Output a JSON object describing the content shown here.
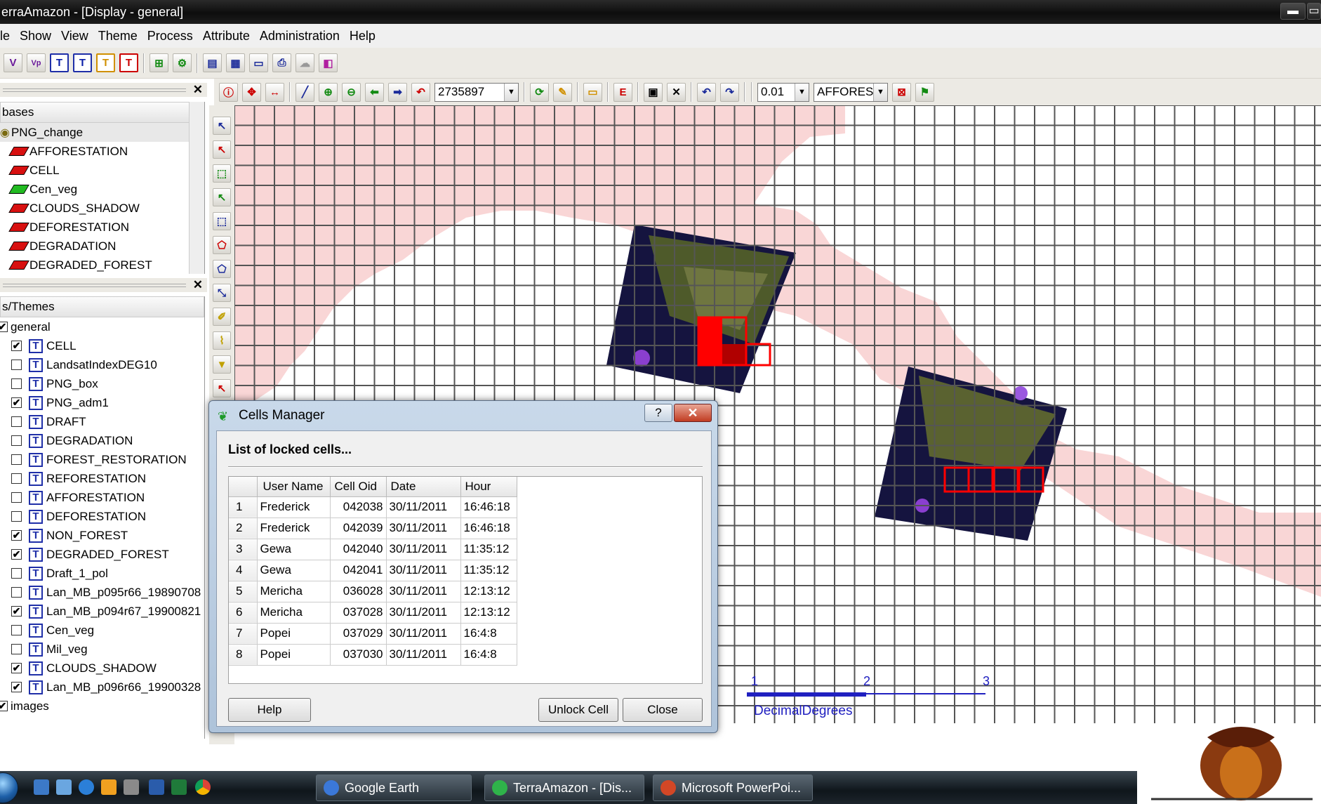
{
  "window": {
    "title": "erraAmazon - [Display - general]",
    "min_label": "▬",
    "max_label": "▭"
  },
  "menu": [
    "le",
    "Show",
    "View",
    "Theme",
    "Process",
    "Attribute",
    "Administration",
    "Help"
  ],
  "toolbar": {
    "scale_value": "2735897",
    "tolerance_value": "0.01",
    "theme_select": "AFFOREST"
  },
  "databases_panel": {
    "header": "bases",
    "database": "PNG_change",
    "layers": [
      {
        "label": "AFFORESTATION",
        "color": "#d81010"
      },
      {
        "label": "CELL",
        "color": "#d81010"
      },
      {
        "label": "Cen_veg",
        "color": "#22bb22"
      },
      {
        "label": "CLOUDS_SHADOW",
        "color": "#d81010"
      },
      {
        "label": "DEFORESTATION",
        "color": "#d81010"
      },
      {
        "label": "DEGRADATION",
        "color": "#d81010"
      },
      {
        "label": "DEGRADED_FOREST",
        "color": "#d81010"
      }
    ]
  },
  "themes_panel": {
    "header": "s/Themes",
    "view_general": "general",
    "view_images": "images",
    "themes": [
      {
        "label": "CELL",
        "checked": "✔"
      },
      {
        "label": "LandsatIndexDEG10",
        "checked": ""
      },
      {
        "label": "PNG_box",
        "checked": ""
      },
      {
        "label": "PNG_adm1",
        "checked": "✔"
      },
      {
        "label": "DRAFT",
        "checked": ""
      },
      {
        "label": "DEGRADATION",
        "checked": ""
      },
      {
        "label": "FOREST_RESTORATION",
        "checked": ""
      },
      {
        "label": "REFORESTATION",
        "checked": ""
      },
      {
        "label": "AFFORESTATION",
        "checked": ""
      },
      {
        "label": "DEFORESTATION",
        "checked": ""
      },
      {
        "label": "NON_FOREST",
        "checked": "✔"
      },
      {
        "label": "DEGRADED_FOREST",
        "checked": "✔"
      },
      {
        "label": "Draft_1_pol",
        "checked": ""
      },
      {
        "label": "Lan_MB_p095r66_19890708",
        "checked": ""
      },
      {
        "label": "Lan_MB_p094r67_19900821",
        "checked": "✔"
      },
      {
        "label": "Cen_veg",
        "checked": ""
      },
      {
        "label": "Mil_veg",
        "checked": ""
      },
      {
        "label": "CLOUDS_SHADOW",
        "checked": "✔"
      },
      {
        "label": "Lan_MB_p096r66_19900328",
        "checked": "✔"
      }
    ]
  },
  "map": {
    "scale_ticks": [
      "1",
      "2",
      "3"
    ],
    "scale_unit": "DecimalDegrees",
    "colors": {
      "land": "#f9d6d6",
      "boundary": "#ffa500",
      "grid": "#555555",
      "locked": "#ff0000"
    }
  },
  "dialog": {
    "title": "Cells Manager",
    "help_glyph": "?",
    "close_glyph": "✕",
    "heading": "List of locked cells...",
    "columns": [
      "User Name",
      "Cell Oid",
      "Date",
      "Hour"
    ],
    "rows": [
      {
        "n": "1",
        "user": "Frederick",
        "oid": "042038",
        "date": "30/11/2011",
        "hour": "16:46:18"
      },
      {
        "n": "2",
        "user": "Frederick",
        "oid": "042039",
        "date": "30/11/2011",
        "hour": "16:46:18"
      },
      {
        "n": "3",
        "user": "Gewa",
        "oid": "042040",
        "date": "30/11/2011",
        "hour": "11:35:12"
      },
      {
        "n": "4",
        "user": "Gewa",
        "oid": "042041",
        "date": "30/11/2011",
        "hour": "11:35:12"
      },
      {
        "n": "5",
        "user": "Mericha",
        "oid": "036028",
        "date": "30/11/2011",
        "hour": "12:13:12"
      },
      {
        "n": "6",
        "user": "Mericha",
        "oid": "037028",
        "date": "30/11/2011",
        "hour": "12:13:12"
      },
      {
        "n": "7",
        "user": "Popei",
        "oid": "037029",
        "date": "30/11/2011",
        "hour": "16:4:8"
      },
      {
        "n": "8",
        "user": "Popei",
        "oid": "037030",
        "date": "30/11/2011",
        "hour": "16:4:8"
      }
    ],
    "buttons": {
      "help": "Help",
      "unlock": "Unlock Cell",
      "close": "Close"
    }
  },
  "taskbar": {
    "tasks": [
      {
        "label": "Google Earth",
        "color": "#3b78d8"
      },
      {
        "label": "TerraAmazon - [Dis...",
        "color": "#2fb34a"
      },
      {
        "label": "Microsoft PowerPoi...",
        "color": "#d24726"
      }
    ]
  }
}
